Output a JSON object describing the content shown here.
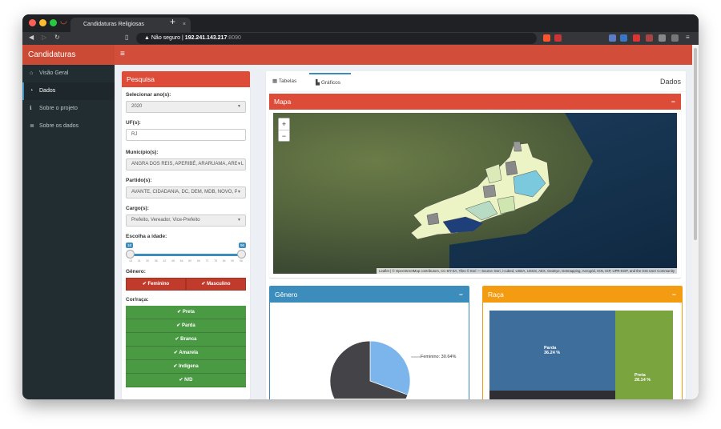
{
  "browser": {
    "tab_title": "Candidaturas Religiosas",
    "security": "Não seguro",
    "url_host": "192.241.143.217",
    "url_port": ":8090",
    "new_tab": "+",
    "close": "×"
  },
  "app": {
    "title": "Candidaturas Religiosas",
    "menu_icon": "≡"
  },
  "sidebar": {
    "items": [
      {
        "label": "Visão Geral",
        "icon": "home-icon"
      },
      {
        "label": "Dados",
        "icon": "dashboard-icon"
      },
      {
        "label": "Sobre o projeto",
        "icon": "info-icon"
      },
      {
        "label": "Sobre os dados",
        "icon": "database-icon"
      }
    ]
  },
  "search": {
    "title": "Pesquisa",
    "year_label": "Selecionar ano(s):",
    "year_value": "2020",
    "uf_label": "UF(s):",
    "uf_value": "RJ",
    "mun_label": "Município(s):",
    "mun_value": "ANGRA DOS REIS, APERIBÉ, ARARUAMA, AREAL",
    "party_label": "Partido(s):",
    "party_value": "AVANTE, CIDADANIA, DC, DEM, MDB, NOVO, PA",
    "office_label": "Cargo(s):",
    "office_value": "Prefeito, Vereador, Vice-Prefeito",
    "age_label": "Escolha a idade:",
    "age_min": "18",
    "age_max": "96",
    "age_ticks": [
      "18",
      "24",
      "30",
      "36",
      "42",
      "48",
      "54",
      "60",
      "66",
      "72",
      "78",
      "84",
      "90",
      "96"
    ],
    "gender_label": "Gênero:",
    "gender_options": [
      "Feminino",
      "Masculino"
    ],
    "race_label": "Cor/raça:",
    "race_options": [
      "Preta",
      "Parda",
      "Branca",
      "Amarela",
      "Indígena",
      "N/D"
    ],
    "check": "✔"
  },
  "main": {
    "tab_tables": "Tabelas",
    "tab_charts": "Gráficos",
    "heading": "Dados",
    "map_title": "Mapa",
    "map_zoom_in": "+",
    "map_zoom_out": "−",
    "map_attribution": "Leaflet | © OpenStreetMap contributors, CC-BY-SA, Tiles © Esri — Source: Esri, i-cubed, USDA, USGS, AEX, GeoEye, Getmapping, Aerogrid, IGN, IGP, UPR-EGP, and the GIS User Community",
    "gender_title": "Gênero",
    "race_title": "Raça",
    "collapse": "−"
  },
  "colors": {
    "header": "#d24e3a",
    "sidebar": "#222d32",
    "red": "#dd4b39",
    "blue": "#3c8dbc",
    "orange": "#f39c12",
    "green": "#4a9a44"
  },
  "chart_data": [
    {
      "type": "pie",
      "title": "Gênero",
      "series": [
        {
          "name": "Feminino",
          "values": [
            30.64
          ]
        },
        {
          "name": "Masculino",
          "values": [
            69.36
          ]
        }
      ],
      "labels": [
        "Feminino: 30.64%"
      ]
    },
    {
      "type": "heatmap",
      "title": "Raça",
      "categories": [
        "Parda",
        "Preta"
      ],
      "values": [
        36.24,
        28.14
      ],
      "labels": [
        "Parda\n36.24 %",
        "Preta\n28.14 %"
      ]
    }
  ]
}
